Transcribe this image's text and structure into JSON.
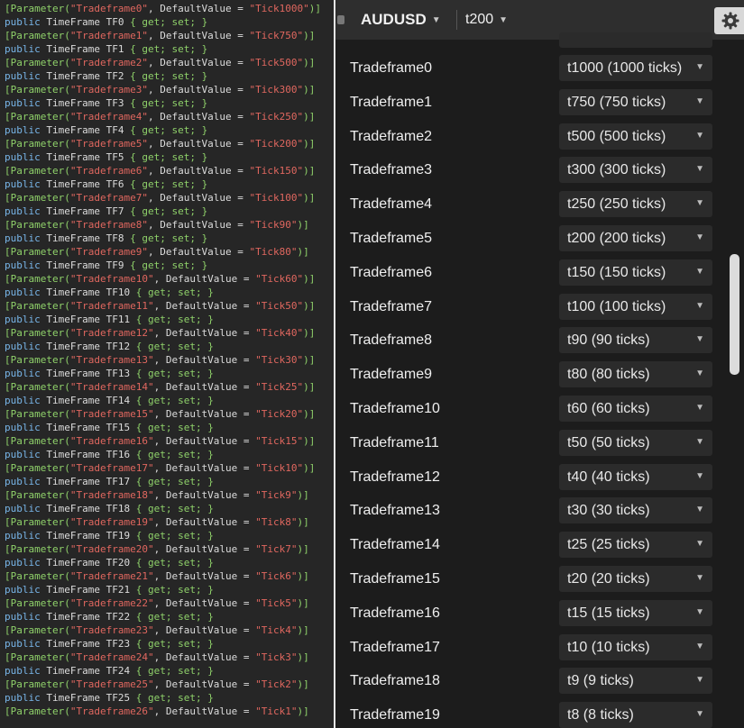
{
  "topbar": {
    "symbol": "AUDUSD",
    "period": "t200"
  },
  "code_lines": [
    {
      "tf": 0,
      "value": "Tick1000"
    },
    {
      "tf": 1,
      "value": "Tick750"
    },
    {
      "tf": 2,
      "value": "Tick500"
    },
    {
      "tf": 3,
      "value": "Tick300"
    },
    {
      "tf": 4,
      "value": "Tick250"
    },
    {
      "tf": 5,
      "value": "Tick200"
    },
    {
      "tf": 6,
      "value": "Tick150"
    },
    {
      "tf": 7,
      "value": "Tick100"
    },
    {
      "tf": 8,
      "value": "Tick90"
    },
    {
      "tf": 9,
      "value": "Tick80"
    },
    {
      "tf": 10,
      "value": "Tick60"
    },
    {
      "tf": 11,
      "value": "Tick50"
    },
    {
      "tf": 12,
      "value": "Tick40"
    },
    {
      "tf": 13,
      "value": "Tick30"
    },
    {
      "tf": 14,
      "value": "Tick25"
    },
    {
      "tf": 15,
      "value": "Tick20"
    },
    {
      "tf": 16,
      "value": "Tick15"
    },
    {
      "tf": 17,
      "value": "Tick10"
    },
    {
      "tf": 18,
      "value": "Tick9"
    },
    {
      "tf": 19,
      "value": "Tick8"
    },
    {
      "tf": 20,
      "value": "Tick7"
    },
    {
      "tf": 21,
      "value": "Tick6"
    },
    {
      "tf": 22,
      "value": "Tick5"
    },
    {
      "tf": 23,
      "value": "Tick4"
    },
    {
      "tf": 24,
      "value": "Tick3"
    },
    {
      "tf": 25,
      "value": "Tick2"
    },
    {
      "tf": 26,
      "value": "Tick1"
    }
  ],
  "params": [
    {
      "label": "Tradeframe0",
      "value": "t1000 (1000 ticks)"
    },
    {
      "label": "Tradeframe1",
      "value": "t750 (750 ticks)"
    },
    {
      "label": "Tradeframe2",
      "value": "t500 (500 ticks)"
    },
    {
      "label": "Tradeframe3",
      "value": "t300 (300 ticks)"
    },
    {
      "label": "Tradeframe4",
      "value": "t250 (250 ticks)"
    },
    {
      "label": "Tradeframe5",
      "value": "t200 (200 ticks)"
    },
    {
      "label": "Tradeframe6",
      "value": "t150 (150 ticks)"
    },
    {
      "label": "Tradeframe7",
      "value": "t100 (100 ticks)"
    },
    {
      "label": "Tradeframe8",
      "value": "t90 (90 ticks)"
    },
    {
      "label": "Tradeframe9",
      "value": "t80 (80 ticks)"
    },
    {
      "label": "Tradeframe10",
      "value": "t60 (60 ticks)"
    },
    {
      "label": "Tradeframe11",
      "value": "t50 (50 ticks)"
    },
    {
      "label": "Tradeframe12",
      "value": "t40 (40 ticks)"
    },
    {
      "label": "Tradeframe13",
      "value": "t30 (30 ticks)"
    },
    {
      "label": "Tradeframe14",
      "value": "t25 (25 ticks)"
    },
    {
      "label": "Tradeframe15",
      "value": "t20 (20 ticks)"
    },
    {
      "label": "Tradeframe16",
      "value": "t15 (15 ticks)"
    },
    {
      "label": "Tradeframe17",
      "value": "t10 (10 ticks)"
    },
    {
      "label": "Tradeframe18",
      "value": "t9 (9 ticks)"
    },
    {
      "label": "Tradeframe19",
      "value": "t8 (8 ticks)"
    }
  ],
  "icons": {
    "settings": "gear-icon",
    "dropdown": "chevron-down-icon"
  },
  "colors": {
    "code_bg": "#262626",
    "code_punctuation": "#8fd16a",
    "code_string": "#e0675f",
    "code_keyword": "#78b5e8",
    "panel_bg": "#1c1c1c",
    "select_bg": "#2b2b2b"
  }
}
